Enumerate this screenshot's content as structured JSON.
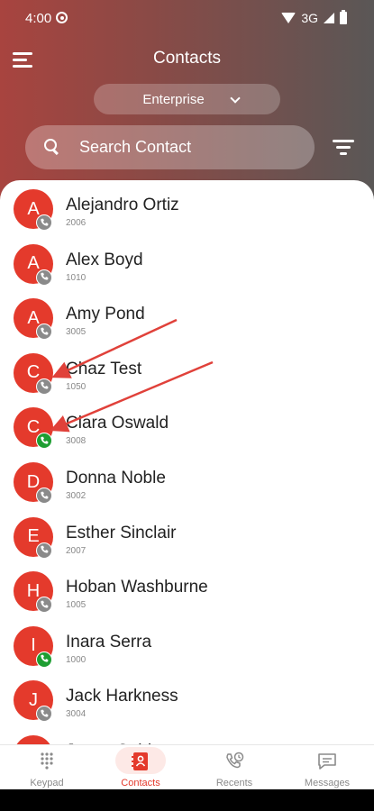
{
  "status_bar": {
    "time": "4:00",
    "network": "3G"
  },
  "header": {
    "title": "Contacts",
    "org_selector": "Enterprise",
    "search_placeholder": "Search Contact"
  },
  "contacts": [
    {
      "initial": "A",
      "name": "Alejandro Ortiz",
      "ext": "2006",
      "status": "offline"
    },
    {
      "initial": "A",
      "name": "Alex Boyd",
      "ext": "1010",
      "status": "offline"
    },
    {
      "initial": "A",
      "name": "Amy Pond",
      "ext": "3005",
      "status": "offline"
    },
    {
      "initial": "C",
      "name": "Chaz Test",
      "ext": "1050",
      "status": "offline"
    },
    {
      "initial": "C",
      "name": "Clara Oswald",
      "ext": "3008",
      "status": "online"
    },
    {
      "initial": "D",
      "name": "Donna Noble",
      "ext": "3002",
      "status": "offline"
    },
    {
      "initial": "E",
      "name": "Esther Sinclair",
      "ext": "2007",
      "status": "offline"
    },
    {
      "initial": "H",
      "name": "Hoban Washburne",
      "ext": "1005",
      "status": "offline"
    },
    {
      "initial": "I",
      "name": "Inara Serra",
      "ext": "1000",
      "status": "online"
    },
    {
      "initial": "J",
      "name": "Jack Harkness",
      "ext": "3004",
      "status": "offline"
    },
    {
      "initial": "J",
      "name": "Jayne Cobb",
      "ext": "",
      "status": "offline"
    }
  ],
  "colors": {
    "accent": "#e43a2c",
    "online": "#1e9e32",
    "offline": "#8a8a8a"
  },
  "nav": [
    {
      "label": "Keypad",
      "icon": "keypad-icon"
    },
    {
      "label": "Contacts",
      "icon": "contacts-icon",
      "active": true
    },
    {
      "label": "Recents",
      "icon": "recents-icon"
    },
    {
      "label": "Messages",
      "icon": "messages-icon"
    }
  ]
}
